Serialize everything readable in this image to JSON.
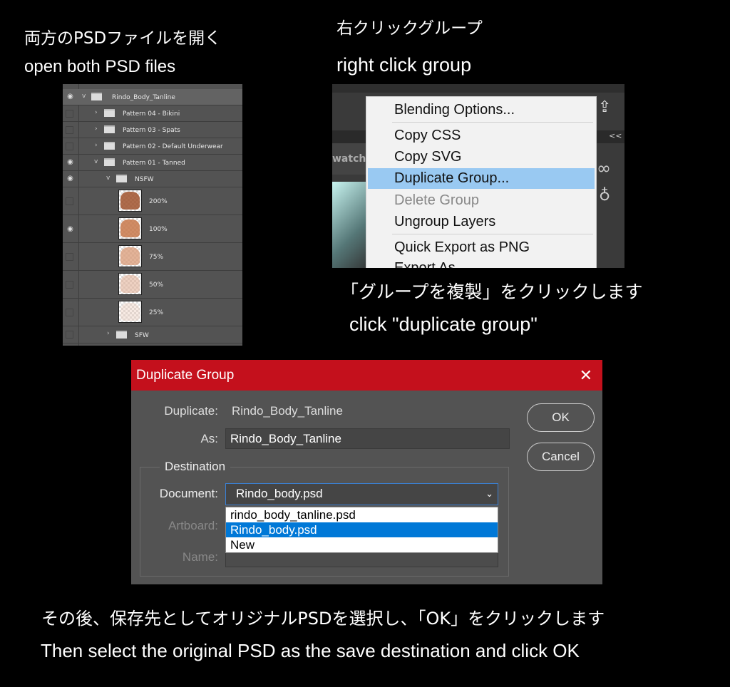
{
  "captions": {
    "step1_ja": "両方のPSDファイルを開く",
    "step1_en": "open both PSD files",
    "step2_ja": "右クリックグループ",
    "step2_en": "right click group",
    "step3_ja": "「グループを複製」をクリックします",
    "step3_en": "click \"duplicate group\"",
    "step4_ja": "その後、保存先としてオリジナルPSDを選択し、「OK」をクリックします",
    "step4_en": "Then select the original PSD as the save destination and click OK"
  },
  "layers": {
    "root": "Rindo_Body_Tanline",
    "groups": [
      "Pattern 04 - Bikini",
      "Pattern 03 - Spats",
      "Pattern 02 - Default Underwear",
      "Pattern 01 - Tanned"
    ],
    "nsfw": "NSFW",
    "items": [
      "200%",
      "100%",
      "75%",
      "50%",
      "25%"
    ],
    "sfw": "SFW"
  },
  "context_menu": {
    "panel_label": "watche",
    "items": [
      "Blending Options...",
      "Copy CSS",
      "Copy SVG",
      "Duplicate Group...",
      "Delete Group",
      "Ungroup Layers",
      "Quick Export as PNG",
      "Export As..."
    ],
    "highlighted": "Duplicate Group...",
    "disabled": "Delete Group",
    "collapse": "<<"
  },
  "dialog": {
    "title": "Duplicate Group",
    "close": "✕",
    "duplicate_label": "Duplicate:",
    "duplicate_value": "Rindo_Body_Tanline",
    "as_label": "As:",
    "as_value": "Rindo_Body_Tanline",
    "destination_label": "Destination",
    "document_label": "Document:",
    "document_value": "Rindo_body.psd",
    "artboard_label": "Artboard:",
    "name_label": "Name:",
    "ok": "OK",
    "cancel": "Cancel",
    "options": [
      "rindo_body_tanline.psd",
      "Rindo_body.psd",
      "New"
    ],
    "selected_option": "Rindo_body.psd",
    "title_color": "#c4101c",
    "highlight_color": "#0078d7"
  }
}
